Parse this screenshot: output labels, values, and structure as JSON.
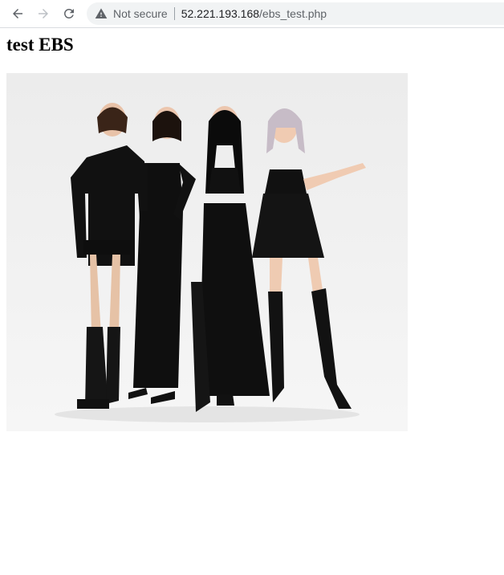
{
  "browser": {
    "security_label": "Not secure",
    "url_host": "52.221.193.168",
    "url_path": "/ebs_test.php",
    "icons": [
      "back-arrow-icon",
      "forward-arrow-icon",
      "reload-icon",
      "warning-icon"
    ]
  },
  "page": {
    "title": "test EBS"
  }
}
